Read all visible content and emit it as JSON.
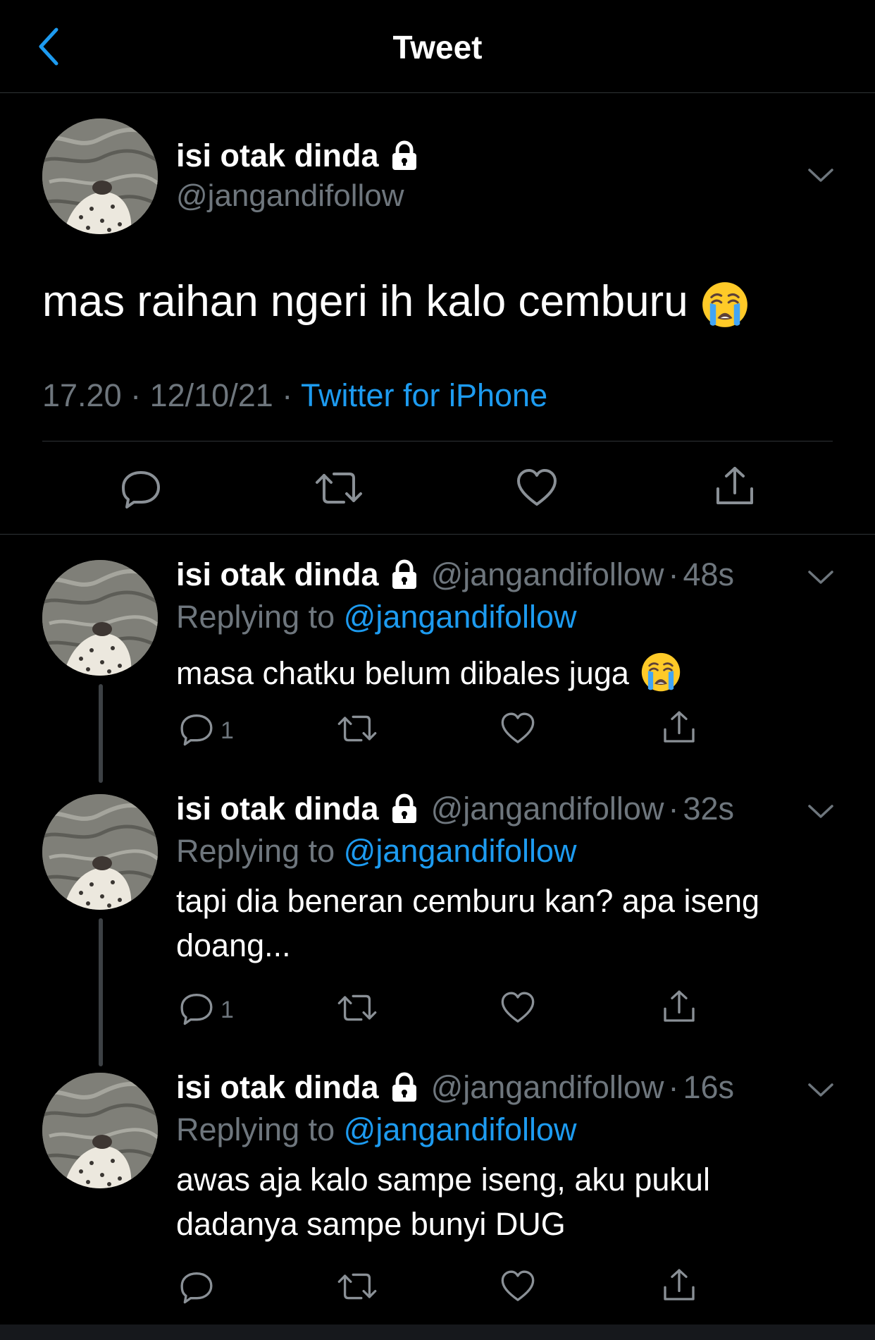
{
  "header": {
    "title": "Tweet"
  },
  "main_tweet": {
    "name": "isi otak dinda",
    "handle": "@jangandifollow",
    "text": "mas raihan ngeri ih kalo cemburu",
    "timestamp": "17.20 · 12/10/21 · ",
    "source": "Twitter for iPhone"
  },
  "replies": [
    {
      "name": "isi otak dinda",
      "handle": "@jangandifollow",
      "dot": "·",
      "time": "48s",
      "replying_prefix": "Replying to ",
      "replying_to": "@jangandifollow",
      "text": "masa chatku belum dibales juga",
      "reply_count": "1"
    },
    {
      "name": "isi otak dinda",
      "handle": "@jangandifollow",
      "dot": "·",
      "time": "32s",
      "replying_prefix": "Replying to ",
      "replying_to": "@jangandifollow",
      "text": "tapi dia beneran cemburu kan? apa iseng doang...",
      "reply_count": "1"
    },
    {
      "name": "isi otak dinda",
      "handle": "@jangandifollow",
      "dot": "·",
      "time": "16s",
      "replying_prefix": "Replying to ",
      "replying_to": "@jangandifollow",
      "text": "awas aja kalo sampe iseng, aku pukul dadanya sampe bunyi DUG",
      "reply_count": ""
    }
  ],
  "icons": {
    "back": "chevron-left-icon",
    "lock": "lock-icon",
    "more": "chevron-down-icon",
    "reply": "reply-bubble-icon",
    "retweet": "retweet-icon",
    "like": "heart-icon",
    "share": "share-icon",
    "emoji": "loudly-crying-face-emoji"
  },
  "colors": {
    "background": "#000000",
    "text": "#ffffff",
    "secondary": "#6e767d",
    "link": "#1d9bf0",
    "divider": "#2f3336"
  }
}
